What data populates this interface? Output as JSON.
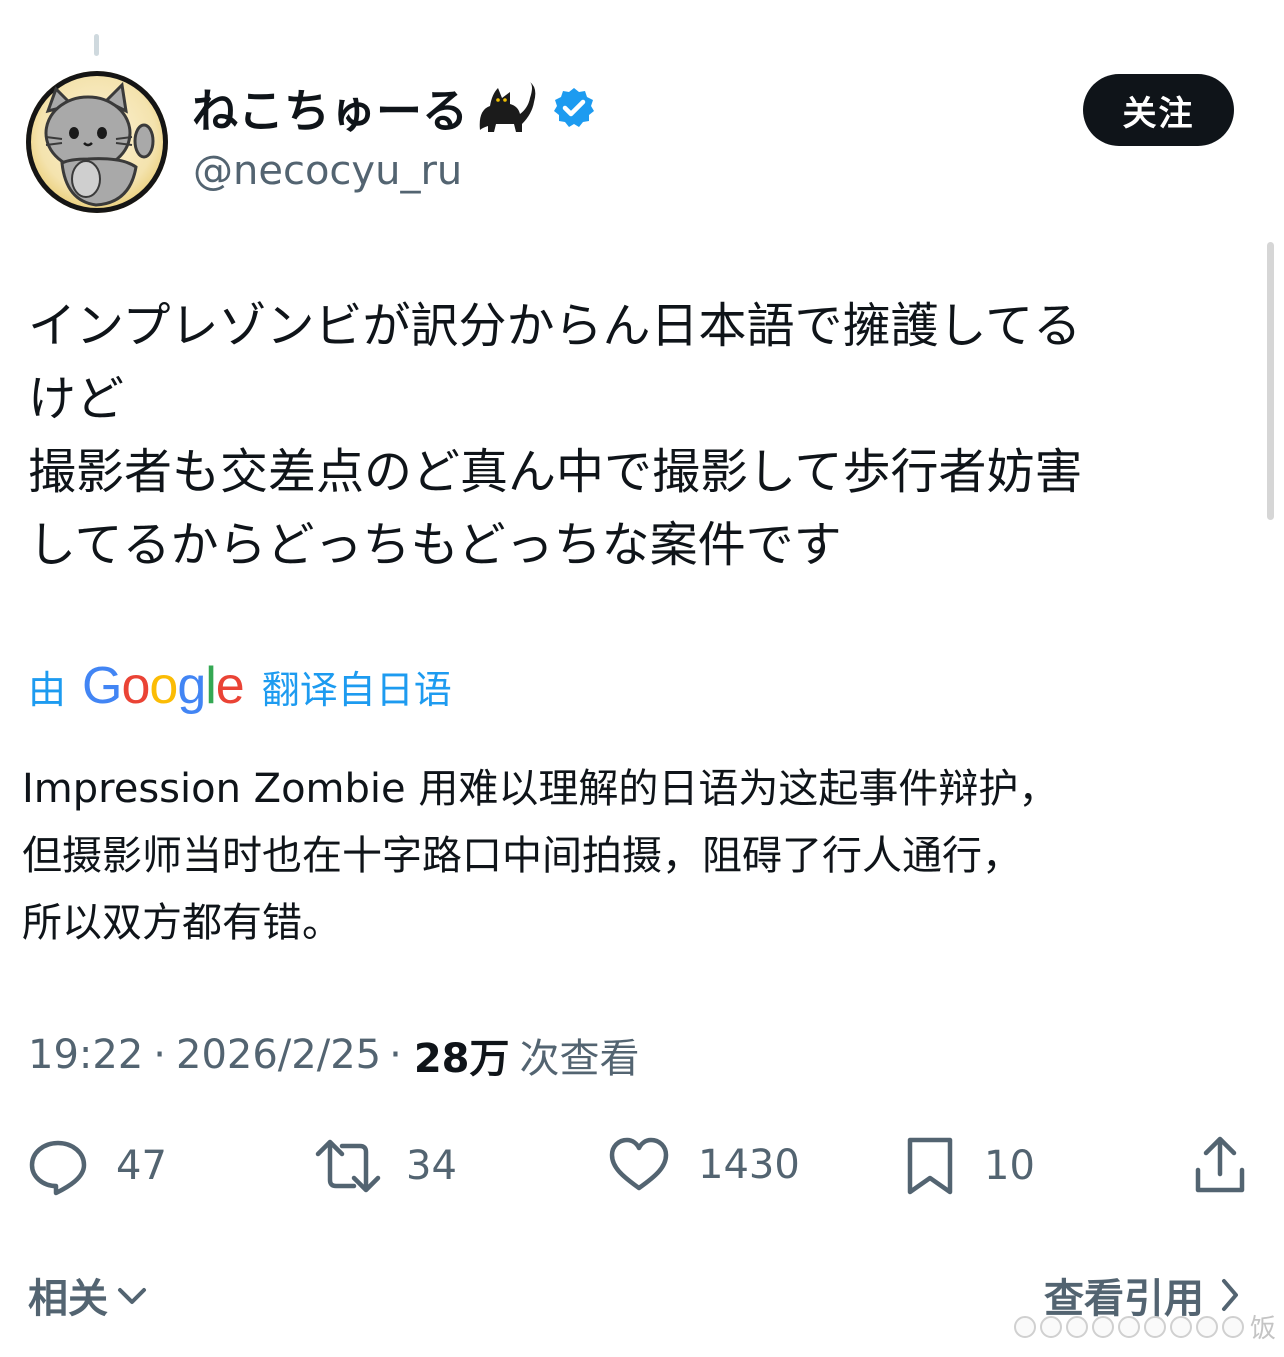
{
  "tweet": {
    "display_name": "ねこちゅーる",
    "name_emoji": "black-cat-emoji",
    "verified_icon": "verified-badge-icon",
    "handle": "@necocyu_ru",
    "follow_label": "关注",
    "text_lines": [
      "インプレゾンビが訳分からん日本語で擁護してる",
      "けど",
      "撮影者も交差点のど真ん中で撮影して歩行者妨害",
      "してるからどっちもどっちな案件です"
    ],
    "translation": {
      "prefix": "由",
      "provider": "Google",
      "suffix": "翻译自日语",
      "lines": [
        "Impression Zombie 用难以理解的日语为这起事件辩护，",
        "但摄影师当时也在十字路口中间拍摄，阻碍了行人通行，",
        "所以双方都有错。"
      ]
    },
    "time": "19:22",
    "separator": "·",
    "date": "2026/2/25",
    "views_count": "28万",
    "views_label": "次查看"
  },
  "actions": {
    "reply_count": "47",
    "retweet_count": "34",
    "like_count": "1430",
    "bookmark_count": "10"
  },
  "footer": {
    "related_label": "相关",
    "view_quotes_label": "查看引用"
  },
  "watermark": {
    "text": "饭"
  },
  "colors": {
    "accent": "#1d9bf0",
    "text_primary": "#0f1419",
    "text_secondary": "#536471",
    "follow_bg": "#0f1419",
    "google_blue": "#4285f4",
    "google_red": "#ea4335",
    "google_yellow": "#fbbc05",
    "google_green": "#34a853"
  }
}
